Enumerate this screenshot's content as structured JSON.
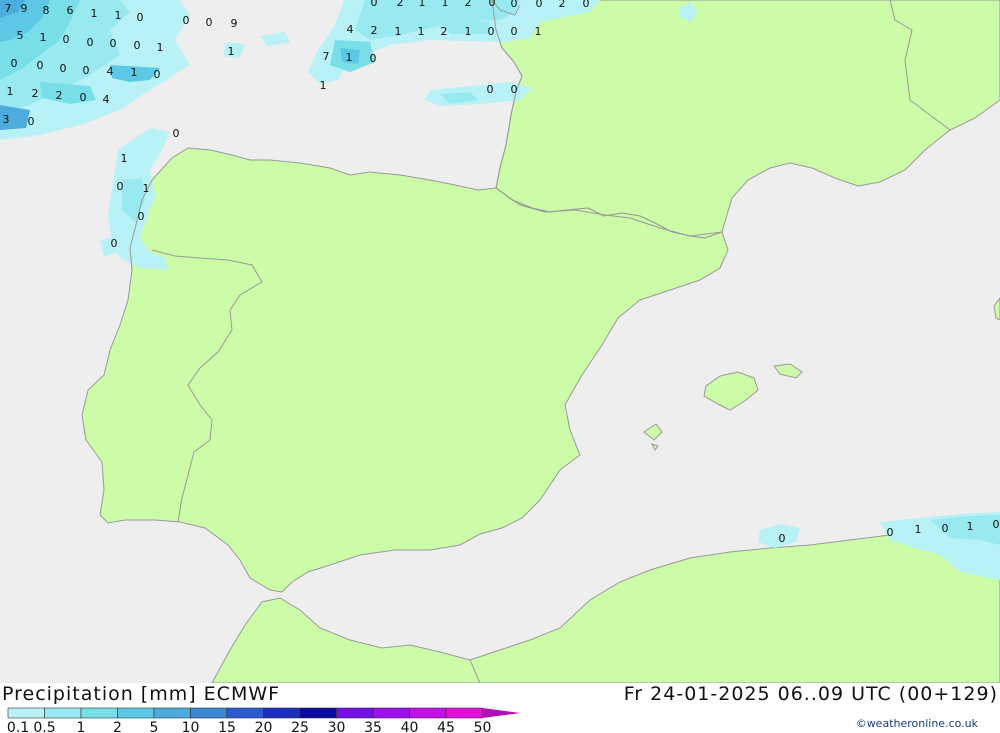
{
  "title_left": "Precipitation [mm] ECMWF",
  "title_right": "Fr 24-01-2025 06..09 UTC (00+129)",
  "credit": "©weatheronline.co.uk",
  "colors": {
    "sea": "#eeeeee",
    "land": "#ccfca8",
    "border": "#999999"
  },
  "legend": {
    "labels": [
      "0.1",
      "0.5",
      "1",
      "2",
      "5",
      "10",
      "15",
      "20",
      "25",
      "30",
      "35",
      "40",
      "45",
      "50"
    ],
    "colors": [
      "#b8f2f6",
      "#98eaf0",
      "#78dfe9",
      "#5cc8e6",
      "#4cacde",
      "#3c88d6",
      "#2c5ad0",
      "#1c2ebf",
      "#0a0aa0",
      "#7410e6",
      "#9e10ea",
      "#c210e6",
      "#e210d8",
      "#b010b8"
    ]
  },
  "map_labels": [
    {
      "t": "7"
    },
    {
      "t": "9"
    },
    {
      "t": "8"
    },
    {
      "t": "6"
    },
    {
      "t": "1"
    },
    {
      "t": "1"
    },
    {
      "t": "0"
    },
    {
      "t": "0"
    },
    {
      "t": "0"
    },
    {
      "t": "9"
    },
    {
      "t": "5"
    },
    {
      "t": "1"
    },
    {
      "t": "0"
    },
    {
      "t": "0"
    },
    {
      "t": "0"
    },
    {
      "t": "0"
    },
    {
      "t": "1"
    },
    {
      "t": "0"
    },
    {
      "t": "0"
    },
    {
      "t": "0"
    },
    {
      "t": "0"
    },
    {
      "t": "4"
    },
    {
      "t": "1"
    },
    {
      "t": "0"
    },
    {
      "t": "1"
    },
    {
      "t": "2"
    },
    {
      "t": "2"
    },
    {
      "t": "0"
    },
    {
      "t": "4"
    },
    {
      "t": "3"
    },
    {
      "t": "0"
    },
    {
      "t": "0"
    },
    {
      "t": "1"
    },
    {
      "t": "0"
    },
    {
      "t": "1"
    },
    {
      "t": "0"
    },
    {
      "t": "0"
    },
    {
      "t": "1"
    },
    {
      "t": "0"
    },
    {
      "t": "2"
    },
    {
      "t": "1"
    },
    {
      "t": "1"
    },
    {
      "t": "2"
    },
    {
      "t": "0"
    },
    {
      "t": "0"
    },
    {
      "t": "0"
    },
    {
      "t": "2"
    },
    {
      "t": "0"
    },
    {
      "t": "4"
    },
    {
      "t": "2"
    },
    {
      "t": "1"
    },
    {
      "t": "1"
    },
    {
      "t": "2"
    },
    {
      "t": "1"
    },
    {
      "t": "0"
    },
    {
      "t": "0"
    },
    {
      "t": "1"
    },
    {
      "t": "7"
    },
    {
      "t": "1"
    },
    {
      "t": "0"
    },
    {
      "t": "0"
    },
    {
      "t": "0"
    },
    {
      "t": "1"
    },
    {
      "t": "0"
    },
    {
      "t": "0"
    },
    {
      "t": "1"
    },
    {
      "t": "0"
    },
    {
      "t": "1"
    },
    {
      "t": "0"
    }
  ]
}
